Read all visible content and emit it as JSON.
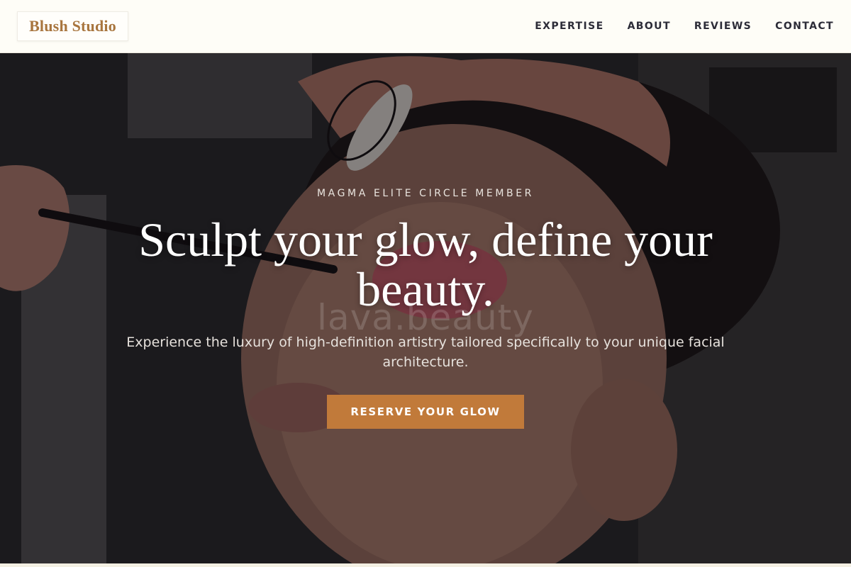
{
  "header": {
    "logo_text": "Blush Studio",
    "nav": [
      {
        "label": "EXPERTISE"
      },
      {
        "label": "ABOUT"
      },
      {
        "label": "REVIEWS"
      },
      {
        "label": "CONTACT"
      }
    ]
  },
  "hero": {
    "kicker": "MAGMA ELITE CIRCLE MEMBER",
    "headline": "Sculpt your glow, define your beauty.",
    "watermark": "lava.beauty",
    "subtext": "Experience the luxury of high-definition artistry tailored specifically to your unique facial architecture.",
    "cta_label": "RESERVE YOUR GLOW"
  },
  "colors": {
    "brand": "#a8753e",
    "cta": "#c17a3a",
    "nav_text": "#2c2c38",
    "header_bg": "#fefdf7"
  }
}
